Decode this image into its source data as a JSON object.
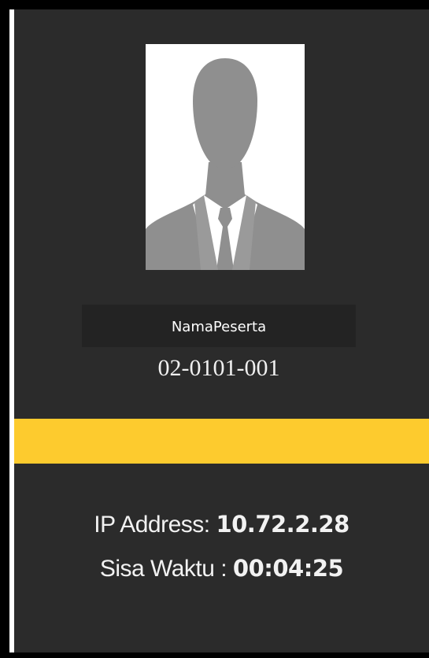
{
  "participant": {
    "name": "NamaPeserta",
    "id": "02-0101-001",
    "photo_icon": "person-silhouette-icon"
  },
  "status_bar": {
    "color": "#fdcb2e"
  },
  "info": {
    "ip_label": "IP Address: ",
    "ip_value": "10.72.2.28",
    "time_label": "Sisa Waktu : ",
    "time_value": "00:04:25"
  },
  "colors": {
    "panel_background": "#2b2b2b",
    "accent": "#fdcb2e",
    "text": "#f2f2f2"
  }
}
